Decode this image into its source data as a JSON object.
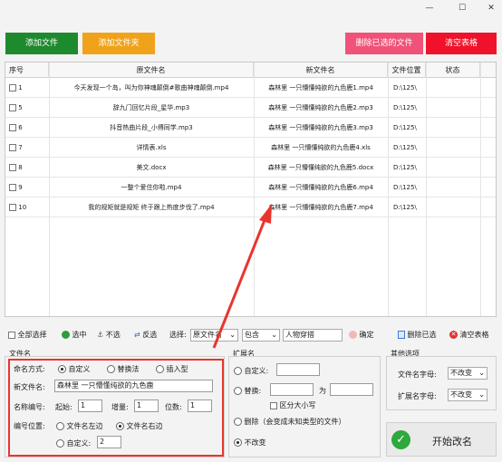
{
  "window": {
    "minimize": "—",
    "maximize": "☐",
    "close": "✕"
  },
  "toolbar": {
    "add_file": "添加文件",
    "add_folder": "添加文件夹",
    "delete_selected": "删除已选的文件",
    "clear_table": "清空表格"
  },
  "table": {
    "headers": [
      "序号",
      "原文件名",
      "新文件名",
      "文件位置",
      "状态"
    ],
    "rows": [
      {
        "index": "1",
        "original": "今天发现一个岛，叫为你神魂颠倒#歌曲神魂颠倒.mp4",
        "new": "森林里 一只懵懂纯欲的九色鹿1.mp4",
        "location": "D:\\125\\",
        "status": ""
      },
      {
        "index": "5",
        "original": "辞九门回忆片段_星华.mp3",
        "new": "森林里 一只懵懂纯欲的九色鹿2.mp3",
        "location": "D:\\125\\",
        "status": ""
      },
      {
        "index": "6",
        "original": "抖音热曲片段_小傅同学.mp3",
        "new": "森林里 一只懵懂纯欲的九色鹿3.mp3",
        "location": "D:\\125\\",
        "status": ""
      },
      {
        "index": "7",
        "original": "详情表.xls",
        "new": "森林里 一只懵懂纯欲的九色鹿4.xls",
        "location": "D:\\125\\",
        "status": ""
      },
      {
        "index": "8",
        "original": "美文.docx",
        "new": "森林里 一只懵懂纯欲的九色鹿5.docx",
        "location": "D:\\125\\",
        "status": ""
      },
      {
        "index": "9",
        "original": "一整个爱住你啦.mp4",
        "new": "森林里 一只懵懂纯欲的九色鹿6.mp4",
        "location": "D:\\125\\",
        "status": ""
      },
      {
        "index": "10",
        "original": "我的规矩就是规矩  终于跟上热度步伐了.mp4",
        "new": "森林里 一只懵懂纯欲的九色鹿7.mp4",
        "location": "D:\\125\\",
        "status": ""
      }
    ]
  },
  "selection_bar": {
    "select_all": "全部选择",
    "select": "选中",
    "deselect": "不选",
    "invert": "反选",
    "choose_label": "选择:",
    "field_value": "原文件名",
    "mode_value": "包含",
    "keyword": "人物穿搭",
    "confirm": "确定",
    "delete_selected": "删除已选",
    "clear_table": "清空表格"
  },
  "filename_panel": {
    "title": "文件名",
    "naming_mode_label": "命名方式:",
    "mode_custom": "自定义",
    "mode_replace": "替换法",
    "mode_insert": "插入型",
    "new_name_label": "新文件名:",
    "new_name_value": "森林里 一只懵懂纯欲的九色鹿",
    "numbering_label": "名称编号:",
    "start_label": "起始:",
    "start_value": "1",
    "increment_label": "增量:",
    "increment_value": "1",
    "digits_label": "位数:",
    "digits_value": "1",
    "position_label": "编号位置:",
    "pos_left": "文件名左边",
    "pos_right": "文件名右边",
    "pos_custom": "自定义:",
    "pos_custom_value": "2"
  },
  "extension_panel": {
    "title": "扩展名",
    "custom": "自定义:",
    "replace": "替换:",
    "replace_to": "为",
    "case_sensitive": "区分大小写",
    "delete": "删除（会变成未知类型的文件）",
    "unchanged": "不改变"
  },
  "other_panel": {
    "title": "其他选项",
    "filename_case_label": "文件名字母:",
    "filename_case_value": "不改变",
    "ext_case_label": "扩展名字母:",
    "ext_case_value": "不改变"
  },
  "start_button": "开始改名",
  "colors": {
    "add_file": "#1e8a2e",
    "add_folder": "#f0a31a",
    "delete_selected": "#f0527a",
    "clear_table": "#f0122a",
    "highlight": "#e8352e"
  }
}
